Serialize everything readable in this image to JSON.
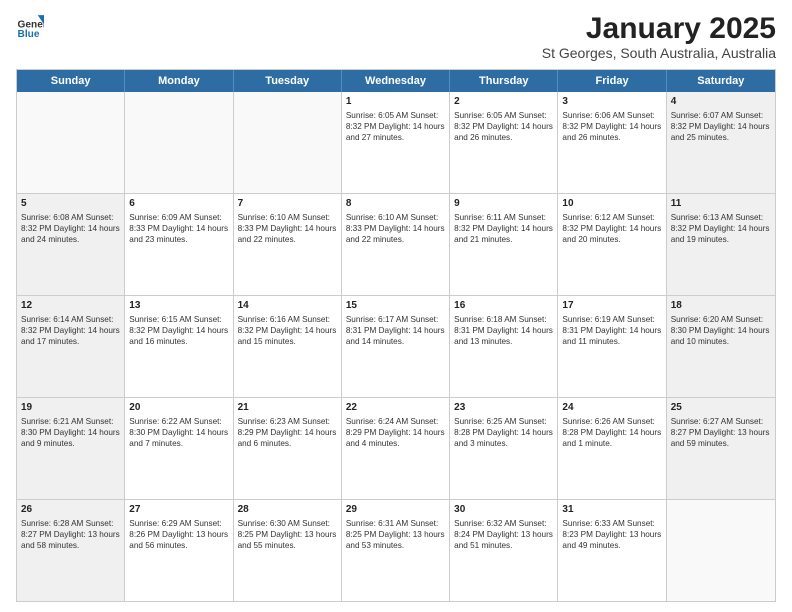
{
  "logo": {
    "general": "General",
    "blue": "Blue"
  },
  "header": {
    "month": "January 2025",
    "location": "St Georges, South Australia, Australia"
  },
  "weekdays": [
    "Sunday",
    "Monday",
    "Tuesday",
    "Wednesday",
    "Thursday",
    "Friday",
    "Saturday"
  ],
  "rows": [
    [
      {
        "day": "",
        "text": "",
        "empty": true
      },
      {
        "day": "",
        "text": "",
        "empty": true
      },
      {
        "day": "",
        "text": "",
        "empty": true
      },
      {
        "day": "1",
        "text": "Sunrise: 6:05 AM\nSunset: 8:32 PM\nDaylight: 14 hours\nand 27 minutes."
      },
      {
        "day": "2",
        "text": "Sunrise: 6:05 AM\nSunset: 8:32 PM\nDaylight: 14 hours\nand 26 minutes."
      },
      {
        "day": "3",
        "text": "Sunrise: 6:06 AM\nSunset: 8:32 PM\nDaylight: 14 hours\nand 26 minutes."
      },
      {
        "day": "4",
        "text": "Sunrise: 6:07 AM\nSunset: 8:32 PM\nDaylight: 14 hours\nand 25 minutes.",
        "shaded": true
      }
    ],
    [
      {
        "day": "5",
        "text": "Sunrise: 6:08 AM\nSunset: 8:32 PM\nDaylight: 14 hours\nand 24 minutes.",
        "shaded": true
      },
      {
        "day": "6",
        "text": "Sunrise: 6:09 AM\nSunset: 8:33 PM\nDaylight: 14 hours\nand 23 minutes."
      },
      {
        "day": "7",
        "text": "Sunrise: 6:10 AM\nSunset: 8:33 PM\nDaylight: 14 hours\nand 22 minutes."
      },
      {
        "day": "8",
        "text": "Sunrise: 6:10 AM\nSunset: 8:33 PM\nDaylight: 14 hours\nand 22 minutes."
      },
      {
        "day": "9",
        "text": "Sunrise: 6:11 AM\nSunset: 8:32 PM\nDaylight: 14 hours\nand 21 minutes."
      },
      {
        "day": "10",
        "text": "Sunrise: 6:12 AM\nSunset: 8:32 PM\nDaylight: 14 hours\nand 20 minutes."
      },
      {
        "day": "11",
        "text": "Sunrise: 6:13 AM\nSunset: 8:32 PM\nDaylight: 14 hours\nand 19 minutes.",
        "shaded": true
      }
    ],
    [
      {
        "day": "12",
        "text": "Sunrise: 6:14 AM\nSunset: 8:32 PM\nDaylight: 14 hours\nand 17 minutes.",
        "shaded": true
      },
      {
        "day": "13",
        "text": "Sunrise: 6:15 AM\nSunset: 8:32 PM\nDaylight: 14 hours\nand 16 minutes."
      },
      {
        "day": "14",
        "text": "Sunrise: 6:16 AM\nSunset: 8:32 PM\nDaylight: 14 hours\nand 15 minutes."
      },
      {
        "day": "15",
        "text": "Sunrise: 6:17 AM\nSunset: 8:31 PM\nDaylight: 14 hours\nand 14 minutes."
      },
      {
        "day": "16",
        "text": "Sunrise: 6:18 AM\nSunset: 8:31 PM\nDaylight: 14 hours\nand 13 minutes."
      },
      {
        "day": "17",
        "text": "Sunrise: 6:19 AM\nSunset: 8:31 PM\nDaylight: 14 hours\nand 11 minutes."
      },
      {
        "day": "18",
        "text": "Sunrise: 6:20 AM\nSunset: 8:30 PM\nDaylight: 14 hours\nand 10 minutes.",
        "shaded": true
      }
    ],
    [
      {
        "day": "19",
        "text": "Sunrise: 6:21 AM\nSunset: 8:30 PM\nDaylight: 14 hours\nand 9 minutes.",
        "shaded": true
      },
      {
        "day": "20",
        "text": "Sunrise: 6:22 AM\nSunset: 8:30 PM\nDaylight: 14 hours\nand 7 minutes."
      },
      {
        "day": "21",
        "text": "Sunrise: 6:23 AM\nSunset: 8:29 PM\nDaylight: 14 hours\nand 6 minutes."
      },
      {
        "day": "22",
        "text": "Sunrise: 6:24 AM\nSunset: 8:29 PM\nDaylight: 14 hours\nand 4 minutes."
      },
      {
        "day": "23",
        "text": "Sunrise: 6:25 AM\nSunset: 8:28 PM\nDaylight: 14 hours\nand 3 minutes."
      },
      {
        "day": "24",
        "text": "Sunrise: 6:26 AM\nSunset: 8:28 PM\nDaylight: 14 hours\nand 1 minute."
      },
      {
        "day": "25",
        "text": "Sunrise: 6:27 AM\nSunset: 8:27 PM\nDaylight: 13 hours\nand 59 minutes.",
        "shaded": true
      }
    ],
    [
      {
        "day": "26",
        "text": "Sunrise: 6:28 AM\nSunset: 8:27 PM\nDaylight: 13 hours\nand 58 minutes.",
        "shaded": true
      },
      {
        "day": "27",
        "text": "Sunrise: 6:29 AM\nSunset: 8:26 PM\nDaylight: 13 hours\nand 56 minutes."
      },
      {
        "day": "28",
        "text": "Sunrise: 6:30 AM\nSunset: 8:25 PM\nDaylight: 13 hours\nand 55 minutes."
      },
      {
        "day": "29",
        "text": "Sunrise: 6:31 AM\nSunset: 8:25 PM\nDaylight: 13 hours\nand 53 minutes."
      },
      {
        "day": "30",
        "text": "Sunrise: 6:32 AM\nSunset: 8:24 PM\nDaylight: 13 hours\nand 51 minutes."
      },
      {
        "day": "31",
        "text": "Sunrise: 6:33 AM\nSunset: 8:23 PM\nDaylight: 13 hours\nand 49 minutes."
      },
      {
        "day": "",
        "text": "",
        "empty": true,
        "shaded": true
      }
    ]
  ]
}
